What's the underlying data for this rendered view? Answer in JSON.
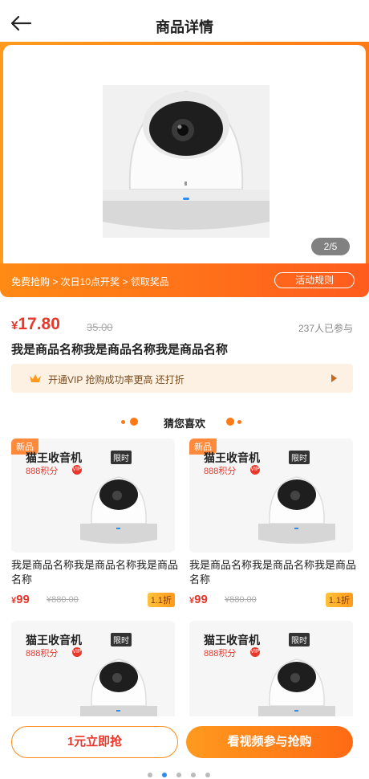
{
  "header": {
    "title": "商品详情"
  },
  "hero": {
    "pager": "2/5"
  },
  "promo": {
    "steps": "免费抢购 > 次日10点开奖 > 领取奖品",
    "rules_label": "活动规则"
  },
  "product": {
    "currency": "¥",
    "price": "17.80",
    "original_price": "35.00",
    "participants": "237人已参与",
    "name": "我是商品名称我是商品名称我是商品名称"
  },
  "vip": {
    "text": "开通VIP 抢购成功率更高 还打折"
  },
  "recommend": {
    "title": "猜您喜欢",
    "cards": [
      {
        "badge": "新品",
        "brand": "猫王收音机",
        "limit": "限时",
        "points": "888积分",
        "name": "我是商品名称我是商品名称我是商品名称",
        "currency": "¥",
        "price": "99",
        "original": "¥880.00",
        "discount": "1.1折"
      },
      {
        "badge": "新品",
        "brand": "猫王收音机",
        "limit": "限时",
        "points": "888积分",
        "name": "我是商品名称我是商品名称我是商品名称",
        "currency": "¥",
        "price": "99",
        "original": "¥880.00",
        "discount": "1.1折"
      },
      {
        "brand": "猫王收音机",
        "limit": "限时",
        "points": "888积分"
      },
      {
        "brand": "猫王收音机",
        "limit": "限时",
        "points": "888积分"
      }
    ]
  },
  "bottom": {
    "left_label": "1元立即抢",
    "right_label": "看视频参与抢购"
  },
  "colors": {
    "accent": "#ff7a16",
    "price": "#e8372b",
    "vip_bg": "#fdf1e4"
  }
}
